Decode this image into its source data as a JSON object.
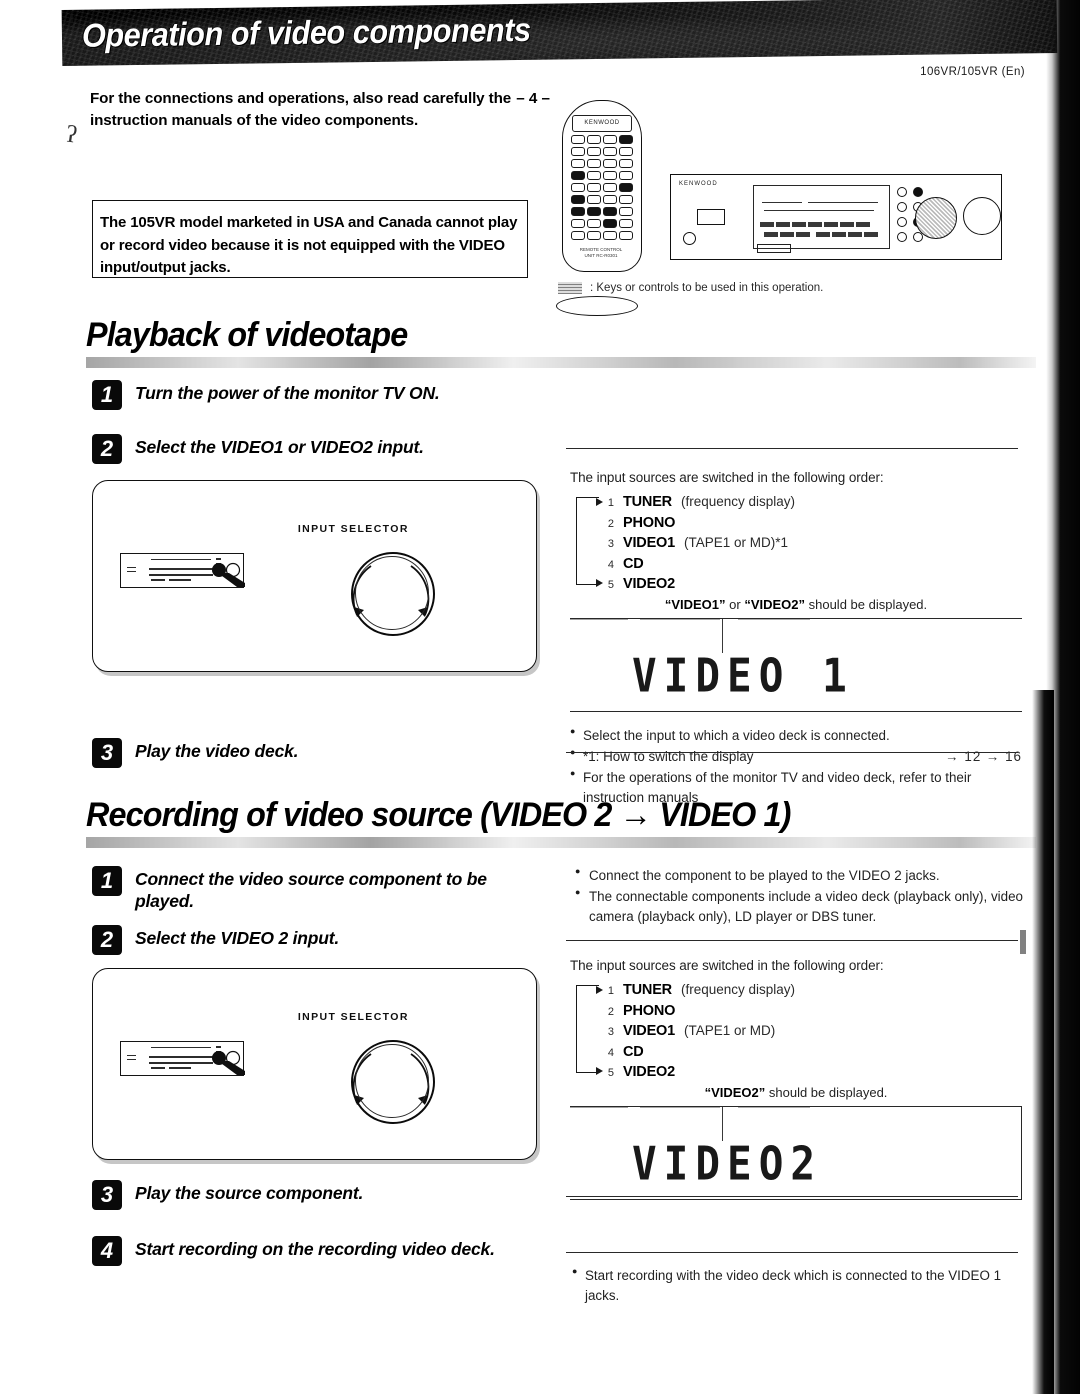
{
  "page": {
    "banner_title": "Operation of video components",
    "model_code": "106VR/105VR (En)",
    "intro_text": "For the connections and operations, also read carefully the instruction manuals of the video components.",
    "intro_pageref": "– 4 –",
    "stray_mark": "ʔ"
  },
  "warning": {
    "text": "The 105VR model marketed in USA and Canada cannot play or record video because it is not equipped with the VIDEO input/output jacks."
  },
  "illustration": {
    "remote_brand": "KENWOOD",
    "remote_footer": "REMOTE CONTROL UNIT RC-R0301",
    "receiver_brand": "KENWOOD",
    "legend_text": ": Keys or controls to be used in this operation."
  },
  "section1": {
    "title": "Playback of videotape",
    "steps": [
      {
        "num": "1",
        "text": "Turn the power of the monitor TV ON."
      },
      {
        "num": "2",
        "text": "Select the VIDEO1 or VIDEO2 input."
      },
      {
        "num": "3",
        "text": "Play the video deck."
      }
    ],
    "panel": {
      "knob_label": "INPUT SELECTOR"
    },
    "right": {
      "lead": "The input sources are switched in the following order:",
      "sources": [
        {
          "num": "1",
          "name": "TUNER",
          "note": "(frequency display)"
        },
        {
          "num": "2",
          "name": "PHONO",
          "note": ""
        },
        {
          "num": "3",
          "name": "VIDEO1",
          "note": "(TAPE1 or MD)*1"
        },
        {
          "num": "4",
          "name": "CD",
          "note": ""
        },
        {
          "num": "5",
          "name": "VIDEO2",
          "note": ""
        }
      ],
      "display_caption_pre": "“VIDEO1”",
      "display_caption_mid": " or ",
      "display_caption_post": "“VIDEO2”",
      "display_caption_tail": " should be displayed.",
      "lcd_text": "VIDEO 1",
      "bullets": [
        {
          "text": "Select the input to which a video deck is connected.",
          "refs": ""
        },
        {
          "text": "*1: How to switch the display",
          "refs": "→ 12  → 16"
        },
        {
          "text": "For the operations of the monitor TV and video deck, refer to their instruction manuals",
          "refs": ""
        }
      ]
    }
  },
  "section2": {
    "title": "Recording of video source (VIDEO 2 → VIDEO 1)",
    "steps": [
      {
        "num": "1",
        "text": "Connect the video source component to be played."
      },
      {
        "num": "2",
        "text": "Select the VIDEO 2 input."
      },
      {
        "num": "3",
        "text": "Play the source component."
      },
      {
        "num": "4",
        "text": "Start recording on the recording video deck."
      }
    ],
    "panel": {
      "knob_label": "INPUT SELECTOR"
    },
    "right": {
      "top_bullets": [
        "Connect the component to be played to the VIDEO 2 jacks.",
        "The connectable components include a video deck (playback only), video camera (playback only), LD player or DBS tuner."
      ],
      "lead": "The input sources are switched in the following order:",
      "sources": [
        {
          "num": "1",
          "name": "TUNER",
          "note": "(frequency display)"
        },
        {
          "num": "2",
          "name": "PHONO",
          "note": ""
        },
        {
          "num": "3",
          "name": "VIDEO1",
          "note": "(TAPE1 or MD)"
        },
        {
          "num": "4",
          "name": "CD",
          "note": ""
        },
        {
          "num": "5",
          "name": "VIDEO2",
          "note": ""
        }
      ],
      "display_caption_pre": "“VIDEO2”",
      "display_caption_tail": " should be displayed.",
      "lcd_text": "VIDEO2",
      "bottom_bullet": "Start recording with the video deck which is connected to the VIDEO 1 jacks."
    }
  },
  "colors": {
    "ink": "#000000",
    "paper": "#ffffff",
    "banner": "#0b0b0b",
    "rule": "#2b2b2b"
  }
}
